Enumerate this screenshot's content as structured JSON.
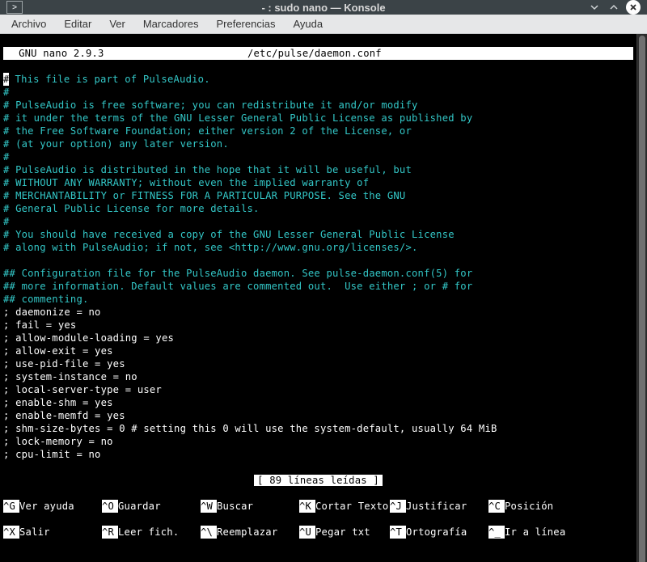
{
  "window": {
    "title": "- : sudo nano — Konsole"
  },
  "menu": {
    "items": [
      "Archivo",
      "Editar",
      "Ver",
      "Marcadores",
      "Preferencias",
      "Ayuda"
    ]
  },
  "nano_header": {
    "left": "  GNU nano 2.9.3",
    "center": "/etc/pulse/daemon.conf"
  },
  "file_lines_comment": [
    "# This file is part of PulseAudio.",
    "#",
    "# PulseAudio is free software; you can redistribute it and/or modify",
    "# it under the terms of the GNU Lesser General Public License as published by",
    "# the Free Software Foundation; either version 2 of the License, or",
    "# (at your option) any later version.",
    "#",
    "# PulseAudio is distributed in the hope that it will be useful, but",
    "# WITHOUT ANY WARRANTY; without even the implied warranty of",
    "# MERCHANTABILITY or FITNESS FOR A PARTICULAR PURPOSE. See the GNU",
    "# General Public License for more details.",
    "#",
    "# You should have received a copy of the GNU Lesser General Public License",
    "# along with PulseAudio; if not, see <http://www.gnu.org/licenses/>.",
    "",
    "## Configuration file for the PulseAudio daemon. See pulse-daemon.conf(5) for",
    "## more information. Default values are commented out.  Use either ; or # for",
    "## commenting."
  ],
  "file_lines_config": [
    "",
    "; daemonize = no",
    "; fail = yes",
    "; allow-module-loading = yes",
    "; allow-exit = yes",
    "; use-pid-file = yes",
    "; system-instance = no",
    "; local-server-type = user",
    "; enable-shm = yes",
    "; enable-memfd = yes",
    "; shm-size-bytes = 0 # setting this 0 will use the system-default, usually 64 MiB",
    "; lock-memory = no",
    "; cpu-limit = no"
  ],
  "status": "[ 89 líneas leídas ]",
  "shortcuts": [
    [
      {
        "key": "^G",
        "label": "Ver ayuda"
      },
      {
        "key": "^O",
        "label": "Guardar"
      },
      {
        "key": "^W",
        "label": "Buscar"
      },
      {
        "key": "^K",
        "label": "Cortar Texto"
      },
      {
        "key": "^J",
        "label": "Justificar"
      },
      {
        "key": "^C",
        "label": "Posición"
      }
    ],
    [
      {
        "key": "^X",
        "label": "Salir"
      },
      {
        "key": "^R",
        "label": "Leer fich."
      },
      {
        "key": "^\\",
        "label": "Reemplazar"
      },
      {
        "key": "^U",
        "label": "Pegar txt"
      },
      {
        "key": "^T",
        "label": "Ortografía"
      },
      {
        "key": "^_",
        "label": "Ir a línea"
      }
    ]
  ]
}
